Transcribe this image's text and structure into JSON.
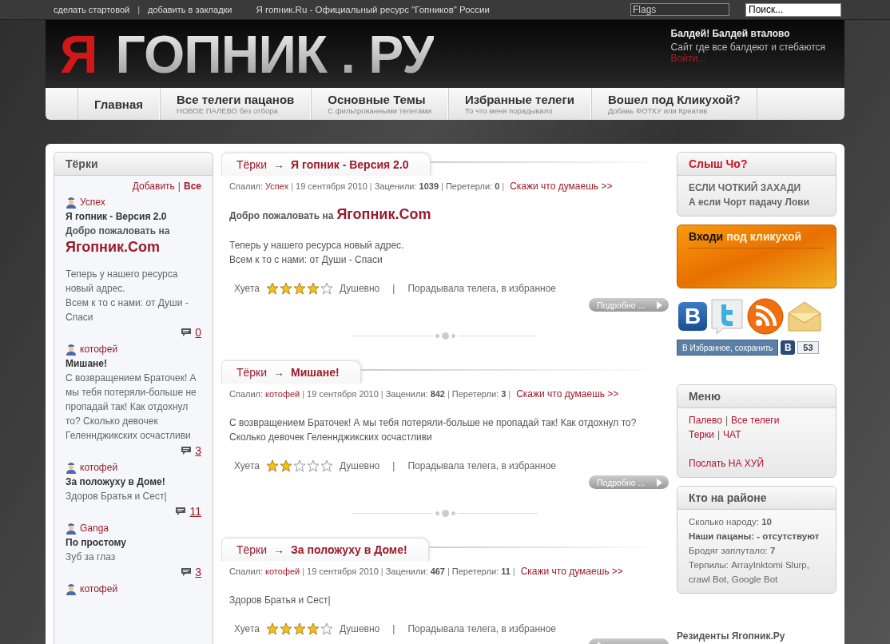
{
  "topbar": {
    "links": [
      "сделать стартовой",
      "добавить в закладки"
    ],
    "separator": "|",
    "site_title": "Я гопник.Ru - Официальный ресурс \"Гопников\" России",
    "flags": {
      "value": "Flags"
    },
    "search": {
      "value": "Поиск..."
    }
  },
  "header": {
    "logo": {
      "first": "Я",
      "rest": "ГОПНИК . РУ"
    },
    "tagline": "Балдей! Балдей вталово",
    "subtitle": "Сайт где все балдеют и стебаются",
    "login": "Войти..."
  },
  "nav": [
    {
      "title": "Главная"
    },
    {
      "title": "Все телеги пацанов",
      "subtitle": "НОВОЕ ПАЛЕВО без отбора"
    },
    {
      "title": "Основные Темы",
      "subtitle": "С фильтрованными телегами"
    },
    {
      "title": "Избранные телеги",
      "subtitle": "То что меня порадывало"
    },
    {
      "title": "Вошел под Кликухой?",
      "subtitle": "Добавь ФОТКУ или Креатив"
    }
  ],
  "terki": {
    "title": "Тёрки",
    "add": "Добавить",
    "separator": "|",
    "all": "Все",
    "items": [
      {
        "author": "Успех",
        "title": "Я гопник - Версия 2.0",
        "intro": "Добро пожаловать на",
        "intro_link": "Ягопник.Com",
        "body": "Теперь у нашего ресурса новый адрес.\nВсем к то с нами: от Души - Спаси",
        "comments": "0"
      },
      {
        "author": "котофей",
        "title": "Мишане!",
        "body": "С возвращением Браточек! А мы тебя потеряли-больше не пропадай так! Как отдохнул то? Сколько девочек Геленнджикских осчастливи",
        "comments": "3"
      },
      {
        "author": "котофей",
        "title": "За положуху в Доме!",
        "body": "Здоров Братья и Сест|",
        "comments": "11"
      },
      {
        "author": "Ganga",
        "title": "По простому",
        "body": "Зуб за глаз",
        "comments": "3"
      },
      {
        "author": "котофей"
      }
    ]
  },
  "posts": [
    {
      "section": "Тёрки",
      "arrow": "→",
      "title": "Я гопник - Версия 2.0",
      "meta": [
        {
          "kind": "label",
          "text": "Спалил:"
        },
        {
          "kind": "link",
          "text": "Успех"
        },
        {
          "kind": "sep",
          "text": "|"
        },
        {
          "kind": "text",
          "text": "19 сентября 2010"
        },
        {
          "kind": "sep",
          "text": "|"
        },
        {
          "kind": "label",
          "text": "Заценили:"
        },
        {
          "kind": "value",
          "text": "1039"
        },
        {
          "kind": "sep",
          "text": "|"
        },
        {
          "kind": "label",
          "text": "Перетерли:"
        },
        {
          "kind": "value",
          "text": "0"
        },
        {
          "kind": "sep",
          "text": "|"
        }
      ],
      "say": "Скажи что думаешь >>",
      "intro": "Добро пожаловать на",
      "intro_link": "Ягопник.Com",
      "body": "Теперь у нашего ресурса новый адрес.\nВсем к то с нами: от Души - Спаси",
      "rating": {
        "worst": "Хуета",
        "stars": 4,
        "best": "Душевно",
        "separator": "|",
        "favorite": "Порадывала телега, в избранное"
      },
      "more": "Подробно ..."
    },
    {
      "section": "Тёрки",
      "arrow": "→",
      "title": "Мишане!",
      "meta": [
        {
          "kind": "label",
          "text": "Спалил:"
        },
        {
          "kind": "link",
          "text": "котофей"
        },
        {
          "kind": "sep",
          "text": "|"
        },
        {
          "kind": "text",
          "text": "19 сентября 2010"
        },
        {
          "kind": "sep",
          "text": "|"
        },
        {
          "kind": "label",
          "text": "Заценили:"
        },
        {
          "kind": "value",
          "text": "842"
        },
        {
          "kind": "sep",
          "text": "|"
        },
        {
          "kind": "label",
          "text": "Перетерли:"
        },
        {
          "kind": "value",
          "text": "3"
        },
        {
          "kind": "sep",
          "text": "|"
        }
      ],
      "say": "Скажи что думаешь >>",
      "body": "С возвращением Браточек! А мы тебя потеряли-больше не пропадай так! Как отдохнул то?\nСколько девочек Геленнджикских осчастливи",
      "rating": {
        "worst": "Хуета",
        "stars": 2,
        "best": "Душевно",
        "separator": "|",
        "favorite": "Порадывала телега, в избранное"
      },
      "more": "Подробно ..."
    },
    {
      "section": "Тёрки",
      "arrow": "→",
      "title": "За положуху в Доме!",
      "meta": [
        {
          "kind": "label",
          "text": "Спалил:"
        },
        {
          "kind": "link",
          "text": "котофей"
        },
        {
          "kind": "sep",
          "text": "|"
        },
        {
          "kind": "text",
          "text": "19 сентября 2010"
        },
        {
          "kind": "sep",
          "text": "|"
        },
        {
          "kind": "label",
          "text": "Заценили:"
        },
        {
          "kind": "value",
          "text": "467"
        },
        {
          "kind": "sep",
          "text": "|"
        },
        {
          "kind": "label",
          "text": "Перетерли:"
        },
        {
          "kind": "value",
          "text": "11"
        },
        {
          "kind": "sep",
          "text": "|"
        }
      ],
      "say": "Скажи что думаешь >>",
      "body": "Здоров Братья и Сест|",
      "rating": {
        "worst": "Хуета",
        "stars": 4,
        "best": "Душевно",
        "separator": "|",
        "favorite": "Порадывала телега, в избранное"
      }
    }
  ],
  "notice": {
    "title": "Слыш Чо?",
    "lines": [
      "ЕСЛИ ЧОТКИЙ ЗАХАДИ",
      "А если Чорт падачу Лови"
    ]
  },
  "login_box": {
    "title_dark": "Входи",
    "title_light": "под кликухой"
  },
  "social": {
    "vk_letter": "B"
  },
  "share": {
    "label": "В Избранное, сохранить",
    "badge": "В",
    "count": "53"
  },
  "menu": {
    "title": "Меню",
    "rows": [
      {
        "links": [
          "Палево",
          "Все телеги"
        ],
        "separator": "|",
        "spaced": false
      },
      {
        "links": [
          "Терки",
          "ЧАТ"
        ],
        "separator": "|",
        "spaced": false
      },
      {
        "links": [
          "Послать НА ХУЙ"
        ],
        "spaced": true
      }
    ]
  },
  "online": {
    "title": "Кто на районе",
    "lines": [
      {
        "text": "Сколько народу: **10**",
        "bold": false
      },
      {
        "text": "Наши пацаны: - отсутствуют",
        "bold": true
      },
      {
        "text": "Бродяг заплутало: **7**",
        "bold": false
      },
      {
        "text": "Терпилы: ArrayInktomi Slurp, crawl Bot, Google Bot",
        "bold": false
      }
    ]
  },
  "residents": "Резиденты Ягопник.Ру"
}
